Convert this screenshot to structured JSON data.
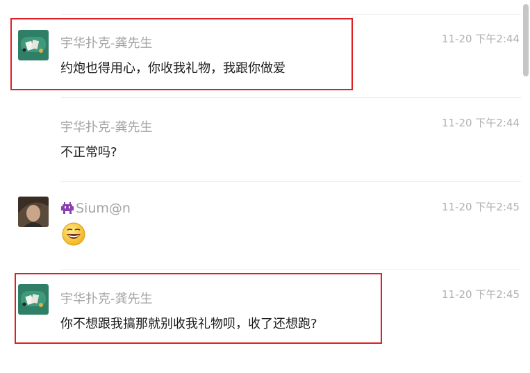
{
  "messages": [
    {
      "sender": "宇华扑克-龚先生",
      "time": "11-20 下午2:44",
      "text": "约炮也得用心，你收我礼物，我跟你做爱",
      "avatar_icon": "poker-table-avatar-icon",
      "highlighted": true
    },
    {
      "sender": "宇华扑克-龚先生",
      "time": "11-20 下午2:44",
      "text": "不正常吗?",
      "highlighted": false
    },
    {
      "sender": "Sium@n",
      "sender_prefix_icon": "alien-monster-icon",
      "time": "11-20 下午2:45",
      "content_icon": "grinning-face-emoji",
      "avatar_icon": "portrait-photo-avatar-icon",
      "highlighted": false
    },
    {
      "sender": "宇华扑克-龚先生",
      "time": "11-20 下午2:45",
      "text": "你不想跟我搞那就别收我礼物呗，收了还想跑?",
      "avatar_icon": "poker-table-avatar-icon",
      "highlighted": true
    }
  ],
  "colors": {
    "highlight_border": "#e01f22",
    "sender_text": "#a4a4a4",
    "message_text": "#1a1a1a",
    "time_text": "#b0b0b0"
  }
}
